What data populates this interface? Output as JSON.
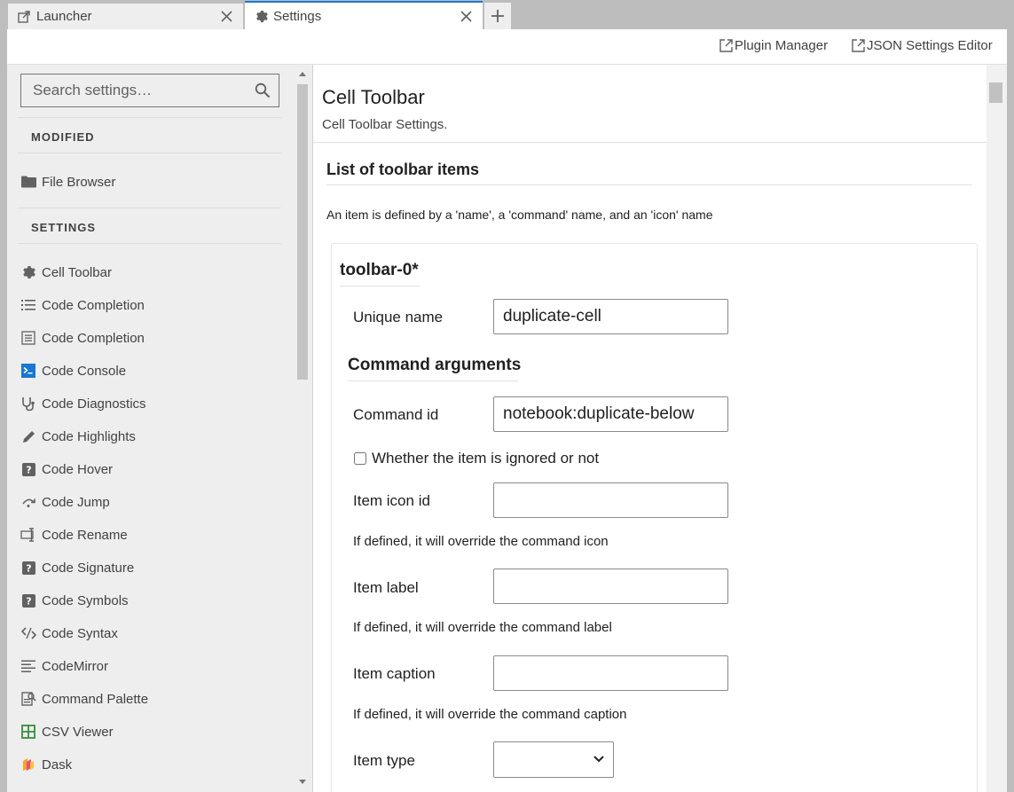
{
  "tabs": [
    {
      "label": "Launcher",
      "icon": "launcher-icon"
    },
    {
      "label": "Settings",
      "icon": "gear-icon"
    }
  ],
  "toolbar": {
    "plugin_manager": "Plugin Manager",
    "json_editor": "JSON Settings Editor"
  },
  "sidebar": {
    "search_placeholder": "Search settings…",
    "modified_label": "MODIFIED",
    "modified_items": [
      {
        "label": "File Browser",
        "icon": "folder-icon"
      }
    ],
    "settings_label": "SETTINGS",
    "items": [
      {
        "label": "Cell Toolbar",
        "icon": "gear-icon"
      },
      {
        "label": "Code Completion",
        "icon": "list-icon"
      },
      {
        "label": "Code Completion",
        "icon": "document-list-icon"
      },
      {
        "label": "Code Console",
        "icon": "console-icon"
      },
      {
        "label": "Code Diagnostics",
        "icon": "stethoscope-icon"
      },
      {
        "label": "Code Highlights",
        "icon": "pencil-icon"
      },
      {
        "label": "Code Hover",
        "icon": "help-icon"
      },
      {
        "label": "Code Jump",
        "icon": "jump-icon"
      },
      {
        "label": "Code Rename",
        "icon": "rename-icon"
      },
      {
        "label": "Code Signature",
        "icon": "help-icon"
      },
      {
        "label": "Code Symbols",
        "icon": "help-icon"
      },
      {
        "label": "Code Syntax",
        "icon": "syntax-icon"
      },
      {
        "label": "CodeMirror",
        "icon": "text-lines-icon"
      },
      {
        "label": "Command Palette",
        "icon": "palette-icon"
      },
      {
        "label": "CSV Viewer",
        "icon": "table-icon"
      },
      {
        "label": "Dask",
        "icon": "dask-icon"
      }
    ]
  },
  "main": {
    "title": "Cell Toolbar",
    "description": "Cell Toolbar Settings.",
    "list_heading": "List of toolbar items",
    "list_description": "An item is defined by a 'name', a 'command' name, and an 'icon' name",
    "item_title": "toolbar-0*",
    "unique_name_label": "Unique name",
    "unique_name_value": "duplicate-cell",
    "command_args_heading": "Command arguments",
    "command_id_label": "Command id",
    "command_id_value": "notebook:duplicate-below",
    "ignored_label": "Whether the item is ignored or not",
    "icon_id_label": "Item icon id",
    "icon_id_value": "",
    "icon_hint": "If defined, it will override the command icon",
    "item_label_label": "Item label",
    "item_label_value": "",
    "label_hint": "If defined, it will override the command label",
    "caption_label": "Item caption",
    "caption_value": "",
    "caption_hint": "If defined, it will override the command caption",
    "item_type_label": "Item type",
    "item_type_value": ""
  },
  "colors": {
    "accent": "#1976d2",
    "sidebar_bg": "#eeeeee",
    "icon": "#616161",
    "console": "#1976d2",
    "table": "#388e3c"
  }
}
